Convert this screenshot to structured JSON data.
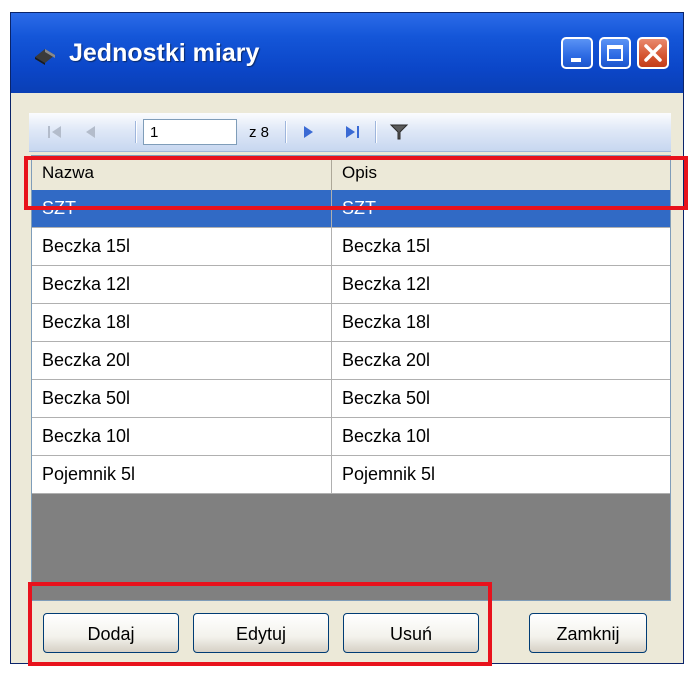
{
  "window": {
    "title": "Jednostki miary"
  },
  "pager": {
    "current_page": "1",
    "of_label": "z 8",
    "icons": [
      "first-page-icon",
      "prev-page-icon",
      "next-page-icon",
      "last-page-icon",
      "filter-icon"
    ]
  },
  "grid": {
    "columns": [
      "Nazwa",
      "Opis"
    ],
    "rows": [
      {
        "nazwa": "SZT",
        "opis": "SZT",
        "selected": true
      },
      {
        "nazwa": "Beczka 15l",
        "opis": "Beczka 15l"
      },
      {
        "nazwa": "Beczka 12l",
        "opis": "Beczka 12l"
      },
      {
        "nazwa": "Beczka 18l",
        "opis": "Beczka 18l"
      },
      {
        "nazwa": "Beczka 20l",
        "opis": "Beczka 20l"
      },
      {
        "nazwa": "Beczka 50l",
        "opis": "Beczka 50l"
      },
      {
        "nazwa": "Beczka 10l",
        "opis": "Beczka 10l"
      },
      {
        "nazwa": "Pojemnik 5l",
        "opis": "Pojemnik 5l"
      }
    ]
  },
  "buttons": {
    "add": "Dodaj",
    "edit": "Edytuj",
    "delete": "Usuń",
    "close": "Zamknij"
  },
  "colors": {
    "selection": "#316ac5",
    "highlight": "#e8121c",
    "titlebar": "#0b46c8"
  }
}
